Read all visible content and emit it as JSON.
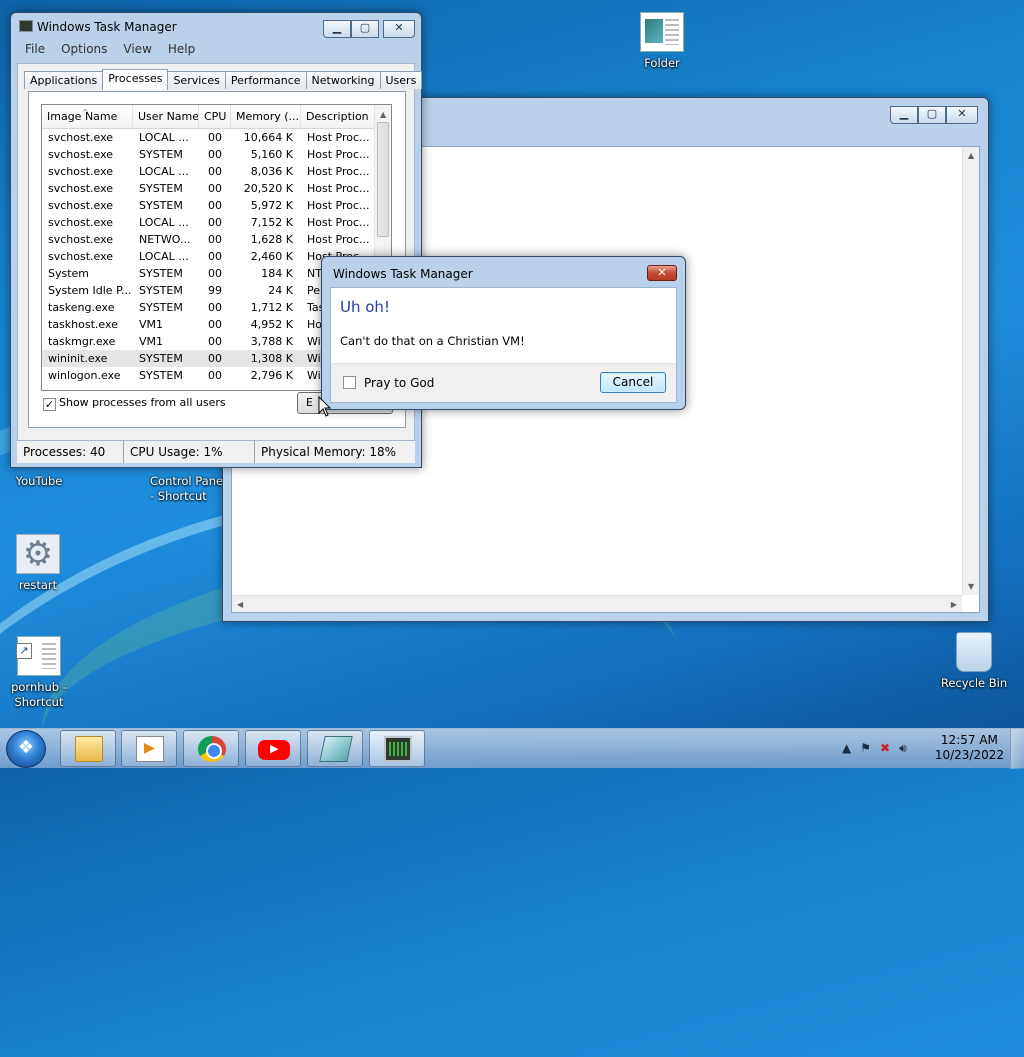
{
  "desktop": {
    "icons": [
      {
        "label": "Folder"
      },
      {
        "label": "YouTube"
      },
      {
        "label": "Control Panel - Shortcut"
      },
      {
        "label": "restart"
      },
      {
        "label": "pornhub - Shortcut"
      },
      {
        "label": "Recycle Bin"
      }
    ]
  },
  "explorer_window": {
    "title": ""
  },
  "task_manager": {
    "title": "Windows Task Manager",
    "menu": [
      "File",
      "Options",
      "View",
      "Help"
    ],
    "tabs": [
      "Applications",
      "Processes",
      "Services",
      "Performance",
      "Networking",
      "Users"
    ],
    "active_tab": "Processes",
    "columns": [
      "Image Name",
      "User Name",
      "CPU",
      "Memory (...",
      "Description"
    ],
    "rows": [
      [
        "svchost.exe",
        "LOCAL ...",
        "00",
        "10,664 K",
        "Host Proc..."
      ],
      [
        "svchost.exe",
        "SYSTEM",
        "00",
        "5,160 K",
        "Host Proc..."
      ],
      [
        "svchost.exe",
        "LOCAL ...",
        "00",
        "8,036 K",
        "Host Proc..."
      ],
      [
        "svchost.exe",
        "SYSTEM",
        "00",
        "20,520 K",
        "Host Proc..."
      ],
      [
        "svchost.exe",
        "SYSTEM",
        "00",
        "5,972 K",
        "Host Proc..."
      ],
      [
        "svchost.exe",
        "LOCAL ...",
        "00",
        "7,152 K",
        "Host Proc..."
      ],
      [
        "svchost.exe",
        "NETWO...",
        "00",
        "1,628 K",
        "Host Proc..."
      ],
      [
        "svchost.exe",
        "LOCAL ...",
        "00",
        "2,460 K",
        "Host Proc..."
      ],
      [
        "System",
        "SYSTEM",
        "00",
        "184 K",
        "NT"
      ],
      [
        "System Idle P...",
        "SYSTEM",
        "99",
        "24 K",
        "Per"
      ],
      [
        "taskeng.exe",
        "SYSTEM",
        "00",
        "1,712 K",
        "Tas"
      ],
      [
        "taskhost.exe",
        "VM1",
        "00",
        "4,952 K",
        "Hos"
      ],
      [
        "taskmgr.exe",
        "VM1",
        "00",
        "3,788 K",
        "Win"
      ],
      [
        "wininit.exe",
        "SYSTEM",
        "00",
        "1,308 K",
        "Win"
      ],
      [
        "winlogon.exe",
        "SYSTEM",
        "00",
        "2,796 K",
        "Win"
      ]
    ],
    "selected_row": "wininit.exe",
    "show_all_label": "Show processes from all users",
    "show_all_checked": true,
    "end_process_label": "E",
    "status": {
      "processes": "Processes: 40",
      "cpu": "CPU Usage: 1%",
      "memory": "Physical Memory: 18%"
    }
  },
  "dialog": {
    "title": "Windows Task Manager",
    "main_instruction": "Uh oh!",
    "message": "Can't do that on a Christian VM!",
    "checkbox_label": "Pray to God",
    "cancel_label": "Cancel"
  },
  "taskbar": {
    "pinned": [
      "folder-icon",
      "media-player-icon",
      "chrome-icon",
      "youtube-icon",
      "notebook-icon",
      "task-manager-icon"
    ],
    "clock_time": "12:57 AM",
    "clock_date": "10/23/2022"
  },
  "colors": {
    "desktop_blue": "#1784cf",
    "dialog_instruction": "#1f3f9a",
    "close_red": "#c44c33"
  }
}
